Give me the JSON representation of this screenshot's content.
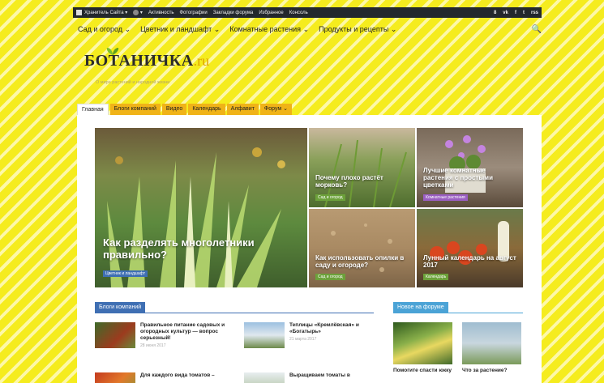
{
  "adminbar": {
    "items": [
      "Хранитель Сайта",
      "Активность",
      "Фотографии",
      "Закладки форума",
      "Избранное",
      "Консоль"
    ],
    "social": [
      "8",
      "vk",
      "f",
      "t",
      "rss"
    ]
  },
  "menu": {
    "items": [
      "Сад и огород",
      "Цветник и ландшафт",
      "Комнатные растения",
      "Продукты и рецепты"
    ]
  },
  "logo": {
    "main": "БОТАНИЧКА",
    "suffix": ".ru"
  },
  "tagline": "О мире растений и народной жизни",
  "tabs": [
    "Главная",
    "Блоги компаний",
    "Видео",
    "Календарь",
    "Алфавит",
    "Форум"
  ],
  "featured": [
    {
      "title": "Как разделять многолетники правильно?",
      "category": "Цветник и ландшафт",
      "color": "#3f6fb3"
    },
    {
      "title": "Почему плохо растёт морковь?",
      "category": "Сад и огород",
      "color": "#6ca13a"
    },
    {
      "title": "Лучшие комнатные растения с простыми цветками",
      "category": "Комнатные растения",
      "color": "#9a5ec2"
    },
    {
      "title": "Как использовать опилки в саду и огороде?",
      "category": "Сад и огород",
      "color": "#6ca13a"
    },
    {
      "title": "Лунный календарь на август 2017",
      "category": "Календарь",
      "color": "#6ca13a"
    }
  ],
  "blogs": {
    "header": "Блоги компаний",
    "posts": [
      {
        "title": "Правильное питание садовых и огородных культур — вопрос серьезный!",
        "date": "28 июня 2017"
      },
      {
        "title": "Теплицы «Кремлёвская» и «Богатырь»",
        "date": "21 марта 2017"
      },
      {
        "title": "Для каждого вида томатов –",
        "date": ""
      },
      {
        "title": "Выращиваем томаты в",
        "date": ""
      }
    ]
  },
  "forum": {
    "header": "Новое на форуме",
    "items": [
      {
        "title": "Помогите спасти юкку"
      },
      {
        "title": "Что за растение?"
      }
    ]
  }
}
